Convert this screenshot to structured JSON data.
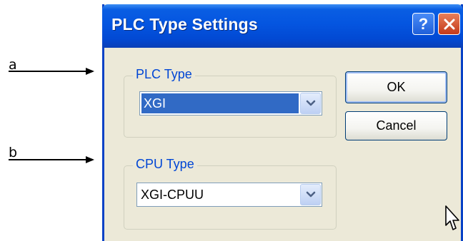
{
  "callouts": [
    {
      "label": "a"
    },
    {
      "label": "b"
    }
  ],
  "dialog": {
    "title": "PLC Type Settings",
    "help_button": "?",
    "plc_group": {
      "legend": "PLC Type",
      "selected_value": "XGI"
    },
    "cpu_group": {
      "legend": "CPU Type",
      "selected_value": "XGI-CPUU"
    },
    "ok_label": "OK",
    "cancel_label": "Cancel"
  },
  "colors": {
    "title_bar": "#0455e0",
    "selection": "#316ac5",
    "group_legend": "#0046d5",
    "close_button": "#c4391a",
    "window_body": "#ece9d8"
  }
}
